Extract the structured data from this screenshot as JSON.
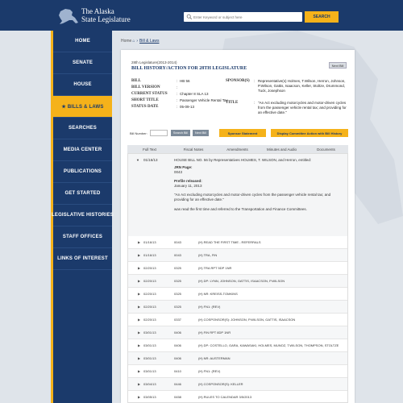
{
  "header": {
    "title_line1": "The Alaska",
    "title_line2": "State Legislature",
    "search_placeholder": "Enter Keyword or subject here",
    "search_button": "SEARCH",
    "colors": {
      "navy": "#1b3a6b",
      "gold": "#f5b21a"
    }
  },
  "sidebar": {
    "items": [
      {
        "label": "HOME"
      },
      {
        "label": "SENATE"
      },
      {
        "label": "HOUSE"
      },
      {
        "label": "★  BILLS & LAWS"
      },
      {
        "label": "SEARCHES"
      },
      {
        "label": "MEDIA CENTER"
      },
      {
        "label": "PUBLICATIONS"
      },
      {
        "label": "GET STARTED"
      },
      {
        "label": "LEGISLATIVE HISTORIES"
      },
      {
        "label": "STAFF OFFICES"
      },
      {
        "label": "LINKS OF INTEREST"
      }
    ]
  },
  "breadcrumb": {
    "home": "Home",
    "current": "Bill & Laws"
  },
  "bill": {
    "legislature": "28th Legislature(2013-2014)",
    "heading": "BILL HISTORY/ACTION FOR 28TH LEGISLATURE",
    "next_bill": "Next Bill",
    "fields": [
      {
        "label": "BILL",
        "value": "HB 56"
      },
      {
        "label": "BILL VERSION",
        "value": ""
      },
      {
        "label": "CURRENT STATUS",
        "value": "Chapter 8 SLA 13"
      },
      {
        "label": "SHORT TITLE",
        "value": "Passenger Vehicle Rental Tax"
      },
      {
        "label": "STATUS DATE",
        "value": "05-09-13"
      }
    ],
    "sponsors_label": "SPONSOR(S)",
    "sponsors_value": "Representative(s) Holmes, T.Wilson, Herron, Johnson, P.Wilson, Gattis, Isaacson, Keller, Stoltze, Drummond, Tuck, Josephson",
    "title_label": "TITLE",
    "title_value": "\"An Act excluding motorcycles and motor-driven cycles from the passenger vehicle rental tax; and providing for an effective date.\""
  },
  "actions": {
    "bill_number_label": "Bill Number:",
    "search_bill": "Search Bill",
    "next_bill": "Next Bill",
    "sponsor_statement": "Sponsor Statement",
    "display_committee": "Display Committee Action with Bill History"
  },
  "tabs": [
    "Full Text",
    "Fiscal Notes",
    "Amendments",
    "Minutes and Audio",
    "Documents"
  ],
  "expanded": {
    "date": "01/16/13",
    "line1": "HOUSE BILL NO. 56 by Representatives HOLMES, T. WILSON, and Herron, entitled:",
    "jrn_label": "JRN Page:",
    "jrn_value": "0043",
    "prefile_label": "Prefile released:",
    "prefile_value": "January 11, 2013",
    "quote": "\"An Act excluding motorcycles and motor-driven cycles from the passenger vehicle rental tax; and providing for an effective date.\"",
    "footer": "was read the first time and referred to the Transportation and Finance Committees."
  },
  "history": [
    {
      "date": "01/16/13",
      "jrn": "0043",
      "action": "(H) READ THE FIRST TIME - REFERRALS"
    },
    {
      "date": "01/16/13",
      "jrn": "0043",
      "action": "(H) TRA, FIN"
    },
    {
      "date": "02/20/13",
      "jrn": "0325",
      "action": "(H) TRA RPT 5DP 1NR"
    },
    {
      "date": "02/20/13",
      "jrn": "0325",
      "action": "(H) DP: LYNN, JOHNSON, GATTIS, ISAACSON, P.WILSON"
    },
    {
      "date": "02/20/13",
      "jrn": "0325",
      "action": "(H) NR: KREISS-TOMKINS"
    },
    {
      "date": "02/20/13",
      "jrn": "0325",
      "action": "(H) FN1: (REV)"
    },
    {
      "date": "02/20/13",
      "jrn": "0337",
      "action": "(H) COSPONSOR(S): JOHNSON, P.WILSON, GATTIS, ISAACSON"
    },
    {
      "date": "03/01/13",
      "jrn": "0406",
      "action": "(H) FIN RPT 8DP 1NR"
    },
    {
      "date": "03/01/13",
      "jrn": "0406",
      "action": "(H) DP: COSTELLO, GARA, KAWASAKI, HOLMES, MUNOZ, T.WILSON, THOMPSON, STOLTZE"
    },
    {
      "date": "03/01/13",
      "jrn": "0406",
      "action": "(H) NR: AUSTERMAN"
    },
    {
      "date": "03/01/13",
      "jrn": "0410",
      "action": "(H) FN1: (REV)"
    },
    {
      "date": "03/04/13",
      "jrn": "0446",
      "action": "(H) COSPONSOR(S): KELLER"
    },
    {
      "date": "03/05/13",
      "jrn": "0458",
      "action": "(H) RULES TO CALENDAR 3/5/2013"
    }
  ]
}
